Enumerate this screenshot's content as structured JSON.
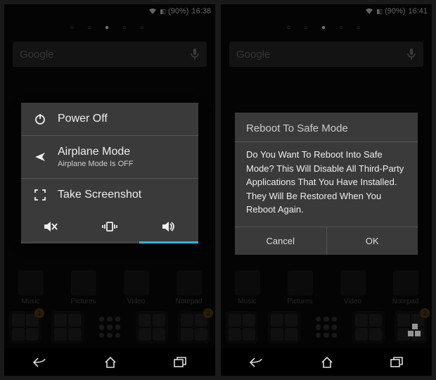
{
  "left": {
    "status": {
      "battery": "(90%)",
      "time": "16:38"
    },
    "search_placeholder": "Google",
    "power_menu": {
      "power_off": "Power Off",
      "airplane": "Airplane Mode",
      "airplane_sub": "Airplane Mode Is OFF",
      "screenshot": "Take Screenshot"
    },
    "apps": {
      "music": "Music",
      "pictures": "Pictures",
      "video": "Video",
      "notepad": "Notepad"
    },
    "badge1": "1",
    "badge2": "2"
  },
  "right": {
    "status": {
      "battery": "(90%)",
      "time": "16:41"
    },
    "search_placeholder": "Google",
    "dialog": {
      "title": "Reboot To Safe Mode",
      "body": "Do You Want To Reboot Into Safe Mode? This Will Disable All Third-Party Applications That You Have Installed. They Will Be Restored When You Reboot Again.",
      "cancel": "Cancel",
      "ok": "OK"
    },
    "apps": {
      "music": "Music",
      "pictures": "Pictures",
      "video": "Video",
      "notepad": "Notepad"
    },
    "badge2": "2"
  }
}
